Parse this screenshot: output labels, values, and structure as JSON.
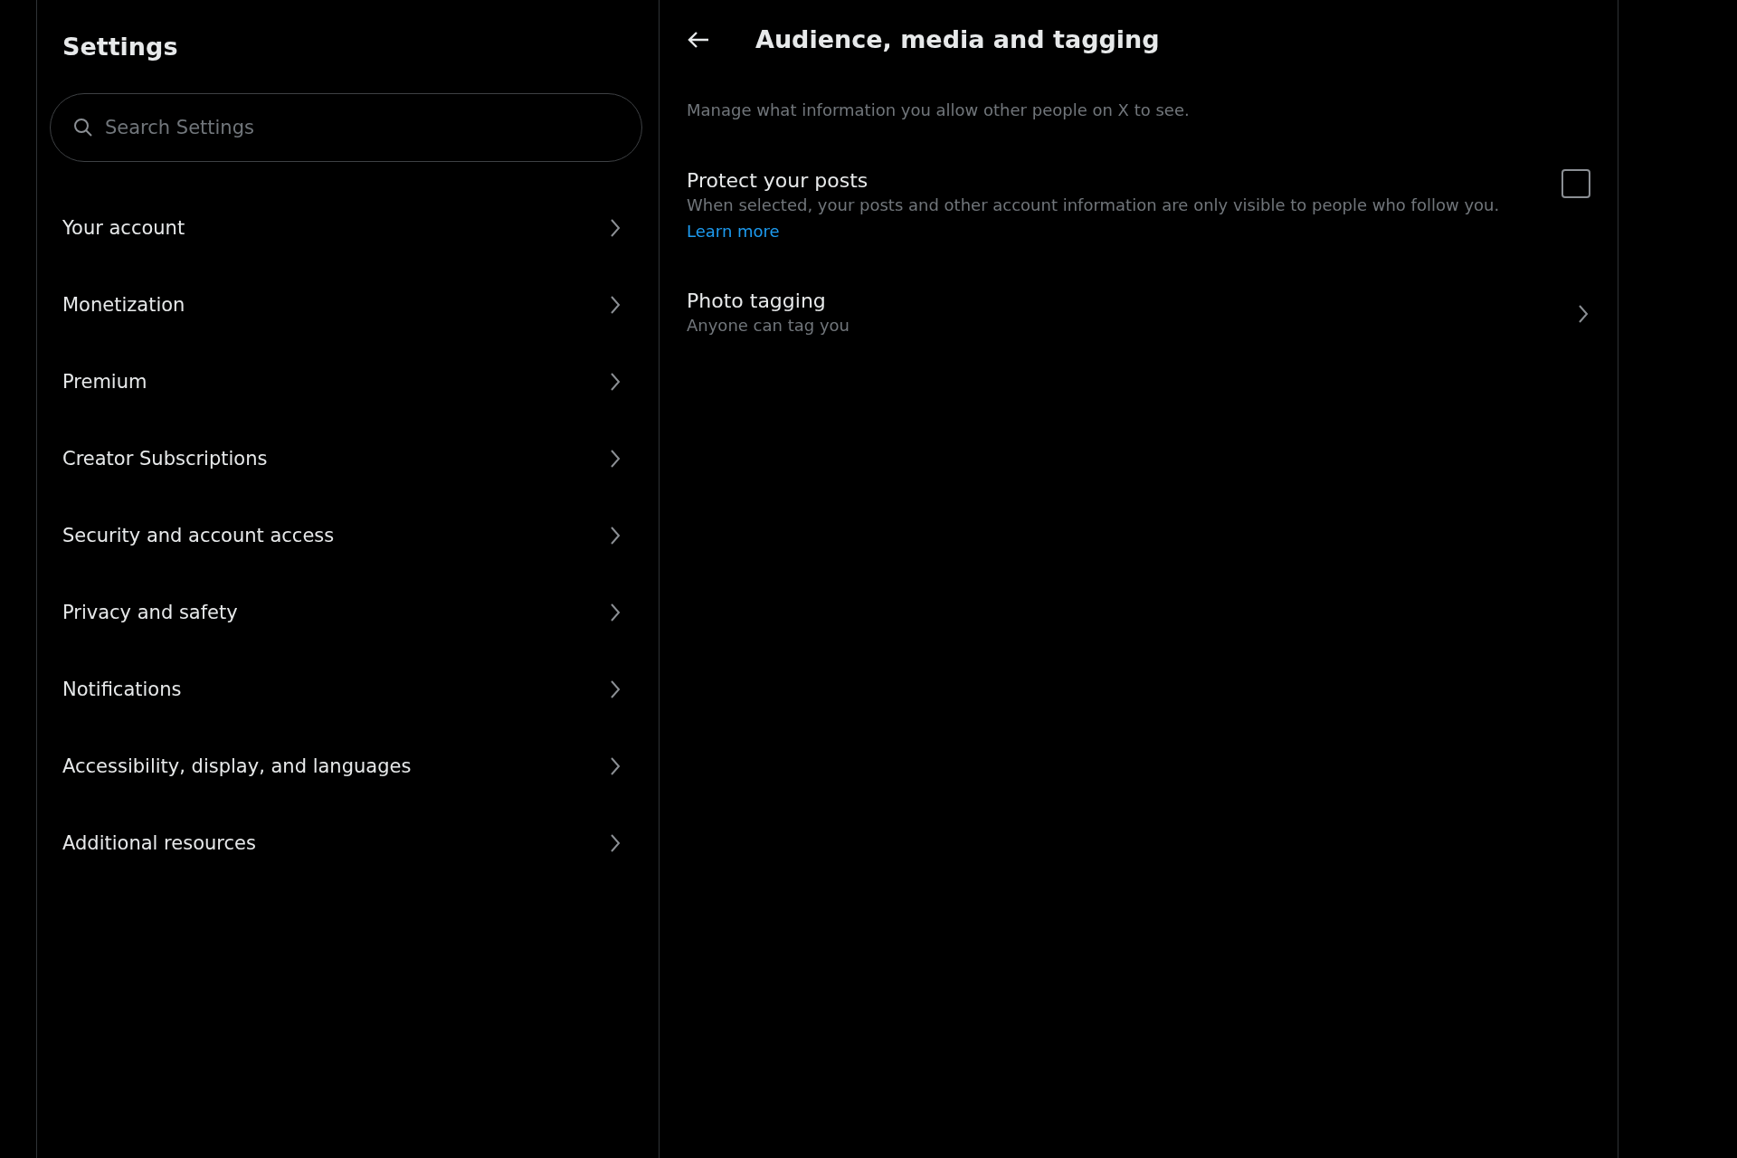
{
  "sidebar": {
    "title": "Settings",
    "search": {
      "placeholder": "Search Settings"
    },
    "items": [
      {
        "label": "Your account"
      },
      {
        "label": "Monetization"
      },
      {
        "label": "Premium"
      },
      {
        "label": "Creator Subscriptions"
      },
      {
        "label": "Security and account access"
      },
      {
        "label": "Privacy and safety"
      },
      {
        "label": "Notifications"
      },
      {
        "label": "Accessibility, display, and languages"
      },
      {
        "label": "Additional resources"
      }
    ]
  },
  "panel": {
    "title": "Audience, media and tagging",
    "description": "Manage what information you allow other people on X to see.",
    "settings": [
      {
        "kind": "checkbox",
        "label": "Protect your posts",
        "description": "When selected, your posts and other account information are only visible to people who follow you.",
        "link": "Learn more",
        "checked": false
      },
      {
        "kind": "link",
        "label": "Photo tagging",
        "description": "Anyone can tag you"
      }
    ]
  }
}
